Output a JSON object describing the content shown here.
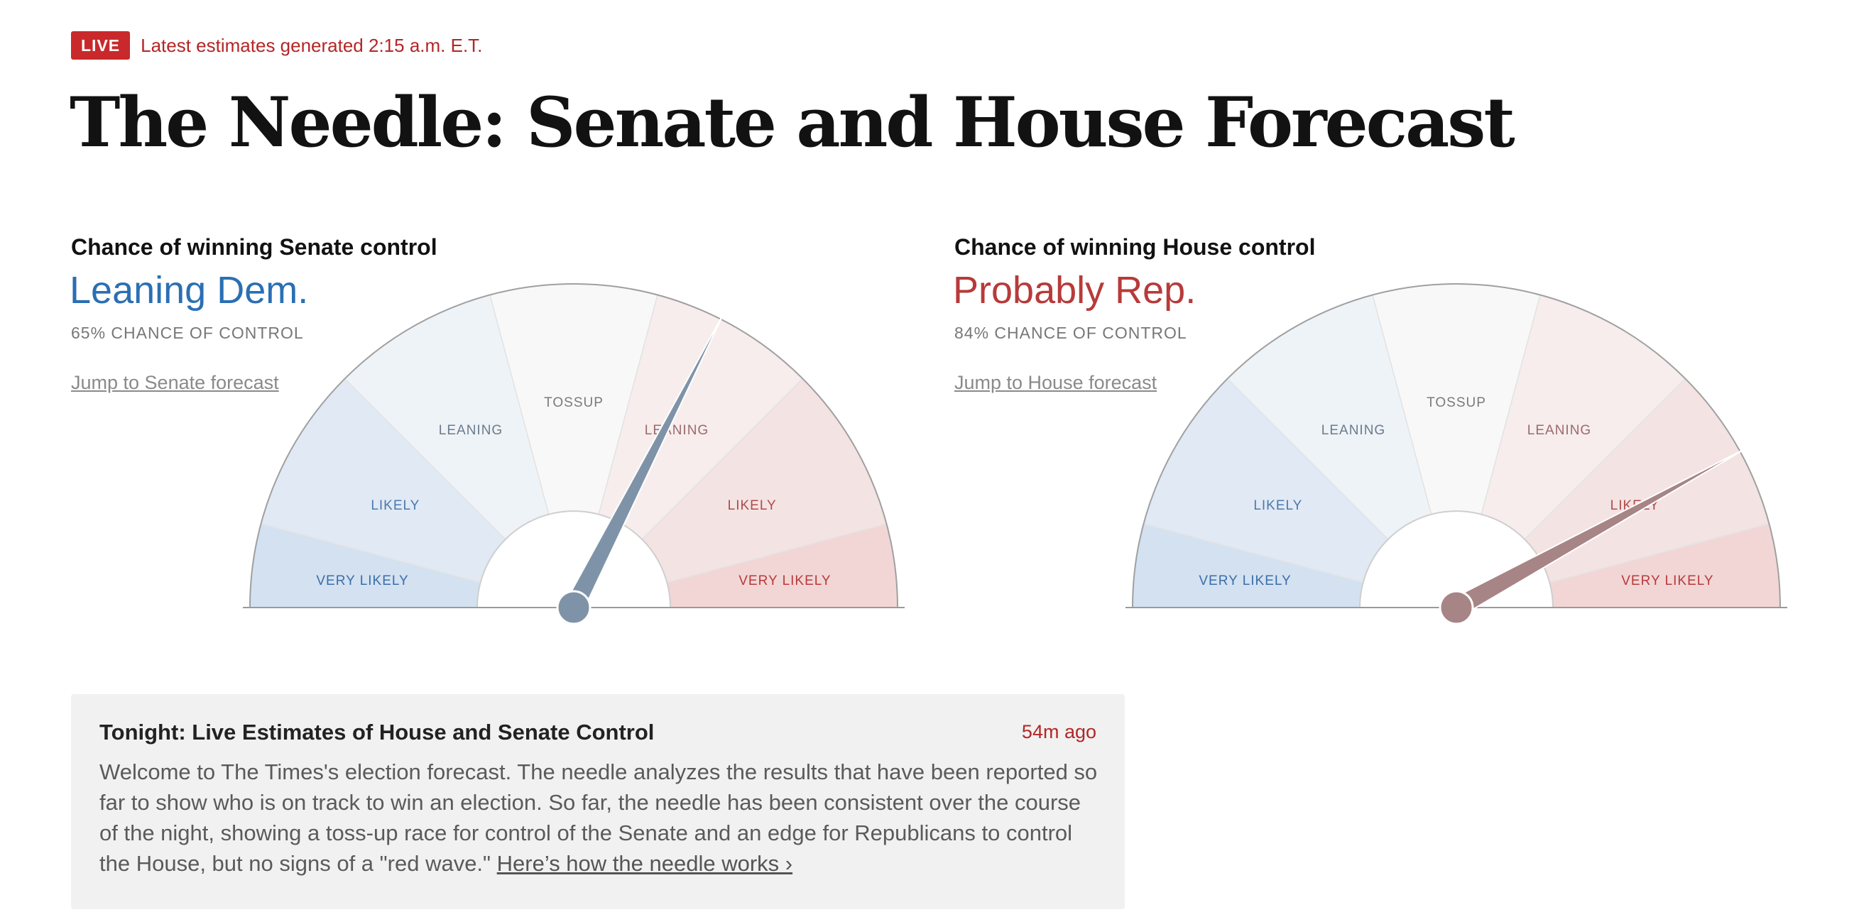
{
  "header": {
    "live_badge": "LIVE",
    "live_text": "Latest estimates generated 2:15 a.m. E.T.",
    "title": "The Needle: Senate and House Forecast"
  },
  "colors": {
    "live_red": "#c9292b",
    "dem_blue": "#2b6fb3",
    "rep_red": "#b73a3a",
    "needle_dem": "#7f93a8",
    "needle_rep": "#a78485"
  },
  "segment_labels": [
    "VERY LIKELY",
    "LIKELY",
    "LEANING",
    "TOSSUP",
    "LEANING",
    "LIKELY",
    "VERY LIKELY"
  ],
  "senate": {
    "title": "Chance of winning Senate control",
    "status": "Leaning Dem.",
    "chance": "65% CHANCE OF CONTROL",
    "link": "Jump to Senate forecast",
    "needle_value": 0.65,
    "party": "dem"
  },
  "house": {
    "title": "Chance of winning House control",
    "status": "Probably Rep.",
    "chance": "84% CHANCE OF CONTROL",
    "link": "Jump to House forecast",
    "needle_value": 0.84,
    "party": "rep"
  },
  "summary": {
    "title": "Tonight: Live Estimates of House and Senate Control",
    "time": "54m ago",
    "body": "Welcome to The Times's election forecast. The needle analyzes the results that have been reported so far to show who is on track to win an election. So far, the needle has been consistent over the course of the night, showing a toss-up race for control of the Senate and an edge for Republicans to control the House, but no signs of a \"red wave.\" ",
    "link": "Here’s how the needle works ›"
  }
}
